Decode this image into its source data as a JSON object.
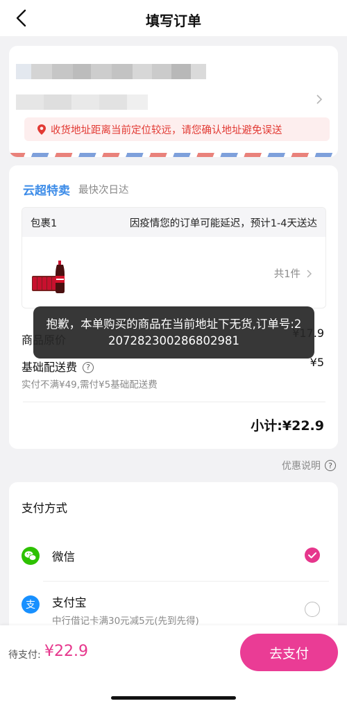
{
  "nav": {
    "title": "填写订单"
  },
  "address": {
    "warning": "收货地址距离当前定位较远，请您确认地址避免误送"
  },
  "order": {
    "shop_name": "云超特卖",
    "shop_sub": "最快次日达",
    "package": {
      "label": "包裹1",
      "notice": "因疫情您的订单可能延迟，预计1-4天送达",
      "count": "共1件"
    },
    "rows": {
      "original_label": "商品原价",
      "original_value": "¥17.9",
      "delivery_label": "基础配送费",
      "delivery_value": "¥5",
      "delivery_note": "实付不满¥49,需付¥5基础配送费"
    },
    "subtotal": "小计:¥22.9"
  },
  "promo_note": "优惠说明",
  "payment": {
    "title": "支付方式",
    "methods": [
      {
        "name": "微信",
        "desc": "",
        "selected": true
      },
      {
        "name": "支付宝",
        "desc": "中行借记卡满30元减5元(先到先得)",
        "selected": false
      }
    ]
  },
  "bottom": {
    "due_label": "待支付:",
    "due_amount": "¥22.9",
    "pay_button": "去支付"
  },
  "toast": "抱歉，本单购买的商品在当前地址下无货,订单号:2207282300286802981",
  "colors": {
    "accent": "#ea3c95",
    "link_blue": "#3b8be8",
    "warning_red": "#e23a34"
  }
}
